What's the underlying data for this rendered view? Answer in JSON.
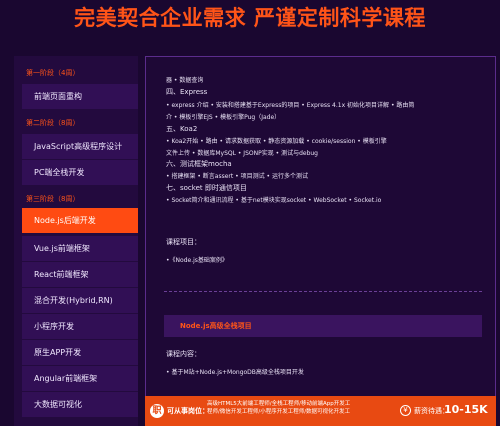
{
  "header": {
    "title": "完美契合企业需求 严谨定制科学课程"
  },
  "sidebar": {
    "stages": [
      {
        "label": "第一阶段（4周）"
      },
      {
        "label": "第二阶段（8周）"
      },
      {
        "label": "第三阶段（8周）"
      }
    ],
    "courses": [
      {
        "label": "前端页面重构"
      },
      {
        "label": "JavaScript高级程序设计"
      },
      {
        "label": "PC端全栈开发"
      },
      {
        "label": "Node.js后端开发"
      },
      {
        "label": "Vue.js前端框架"
      },
      {
        "label": "React前端框架"
      },
      {
        "label": "混合开发(Hybrid,RN)"
      },
      {
        "label": "小程序开发"
      },
      {
        "label": "原生APP开发"
      },
      {
        "label": "Angular前端框架"
      },
      {
        "label": "大数据可视化"
      }
    ],
    "active_course": "Node.js后端开发"
  },
  "content": {
    "lines": [
      "器   • 数据查询",
      "四、Express",
      "• express 介绍   • 安装和搭建基于Express的项目   • Express 4.1x 初始化项目详解   • 路由简",
      "介   • 模板引擎EJS   • 模板引擎Pug（Jade）",
      "五、Koa2",
      "• Koa2开始   • 路由   • 请求数据获取   • 静态资源加载   • cookie/session   • 模板引擎",
      "文件上传   • 数据库MySQL   • JSONP实现   • 测试与debug",
      "六、测试框架mocha",
      "• 搭建框架   • 断言assert   • 项目测试   • 运行多个测试",
      "七、socket 即时通信项目",
      "• Socket简介和通讯流程   • 基于net模块实现socket   • WebSocket   • Socket.io"
    ],
    "project_heading": "课程项目：",
    "project_item": "•《Node.js基础案例》",
    "section_title": "Node.js高级全栈项目",
    "course_content_heading": "课程内容：",
    "course_content_item": "• 基于M站+Node.js+MongoDB高级全栈项目开发"
  },
  "footer": {
    "icon": "职",
    "positions_label": "可从事岗位：",
    "positions_line1": "高级HTML5大前端工程师/全栈工程师/移动前端App开发工",
    "positions_line2": "程师/微信开发工程师/小程序开发工程师/数据可视化开发工",
    "salary_icon": "¥",
    "salary_label": "薪资待遇：",
    "salary_value": "10-15K"
  },
  "colors": {
    "accent": "#ff5418",
    "background": "#1a0730",
    "sidebar": "#230a3e",
    "footer": "#e84a12"
  }
}
